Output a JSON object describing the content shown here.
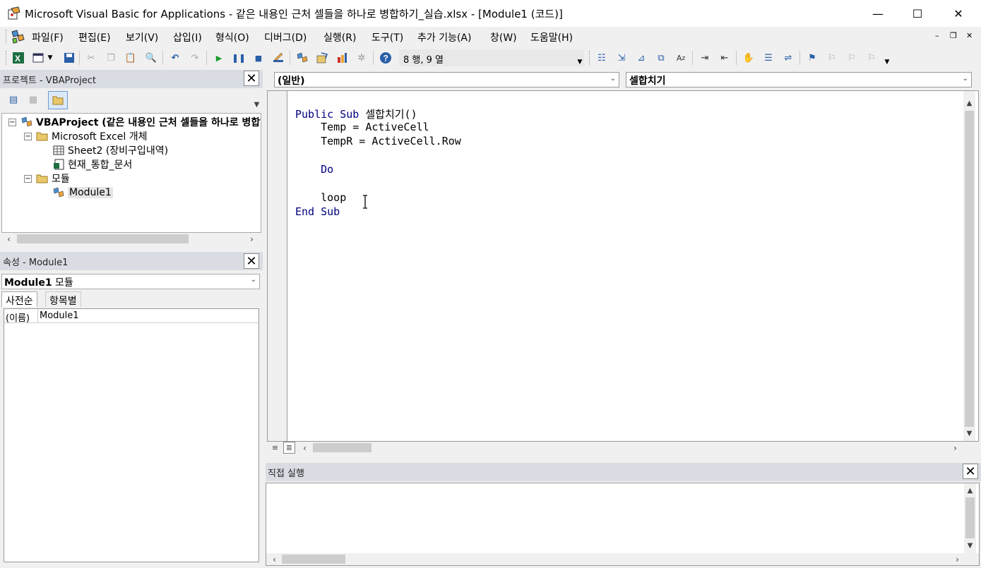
{
  "window": {
    "title": "Microsoft Visual Basic for Applications - 같은 내용인 근처 셀들을 하나로 병합하기_실습.xlsx - [Module1 (코드)]",
    "minimize": "—",
    "maximize": "☐",
    "close": "✕"
  },
  "menu": {
    "items": [
      "파일(F)",
      "편집(E)",
      "보기(V)",
      "삽입(I)",
      "형식(O)",
      "디버그(D)",
      "실행(R)",
      "도구(T)",
      "추가 기능(A)",
      "창(W)",
      "도움말(H)"
    ],
    "mdi_min": "–",
    "mdi_restore": "❐",
    "mdi_close": "✕"
  },
  "toolbar": {
    "cursor_position": "8 행, 9 열"
  },
  "project": {
    "header": "프로젝트 - VBAProject",
    "close": "✕",
    "tree": {
      "root": "VBAProject (같은 내용인 근처 셀들을 하나로 병합하기_실습.xlsx)",
      "excel_objects": "Microsoft Excel 개체",
      "sheet2": "Sheet2 (장비구입내역)",
      "workbook": "현재_통합_문서",
      "modules": "모듈",
      "module1": "Module1"
    }
  },
  "properties": {
    "header": "속성 - Module1",
    "close": "✕",
    "object_name": "Module1",
    "object_type": "모듈",
    "tab_alpha": "사전순",
    "tab_categorized": "항목별",
    "rows": [
      {
        "key": "(이름)",
        "value": "Module1"
      }
    ]
  },
  "code": {
    "object_combo": "(일반)",
    "proc_combo": "셀합치기",
    "lines": [
      {
        "kw": "Public Sub ",
        "rest": "셀합치기()"
      },
      {
        "kw": "",
        "rest": "    Temp = ActiveCell"
      },
      {
        "kw": "",
        "rest": "    TempR = ActiveCell.Row"
      },
      {
        "kw": "",
        "rest": ""
      },
      {
        "kw": "    Do",
        "rest": ""
      },
      {
        "kw": "",
        "rest": ""
      },
      {
        "kw": "",
        "rest": "    loop"
      },
      {
        "kw": "End Sub",
        "rest": ""
      }
    ]
  },
  "immediate": {
    "header": "직접 실행",
    "close": "✕"
  },
  "colors": {
    "keyword": "#00007f",
    "panel_header": "#d9dde3"
  }
}
